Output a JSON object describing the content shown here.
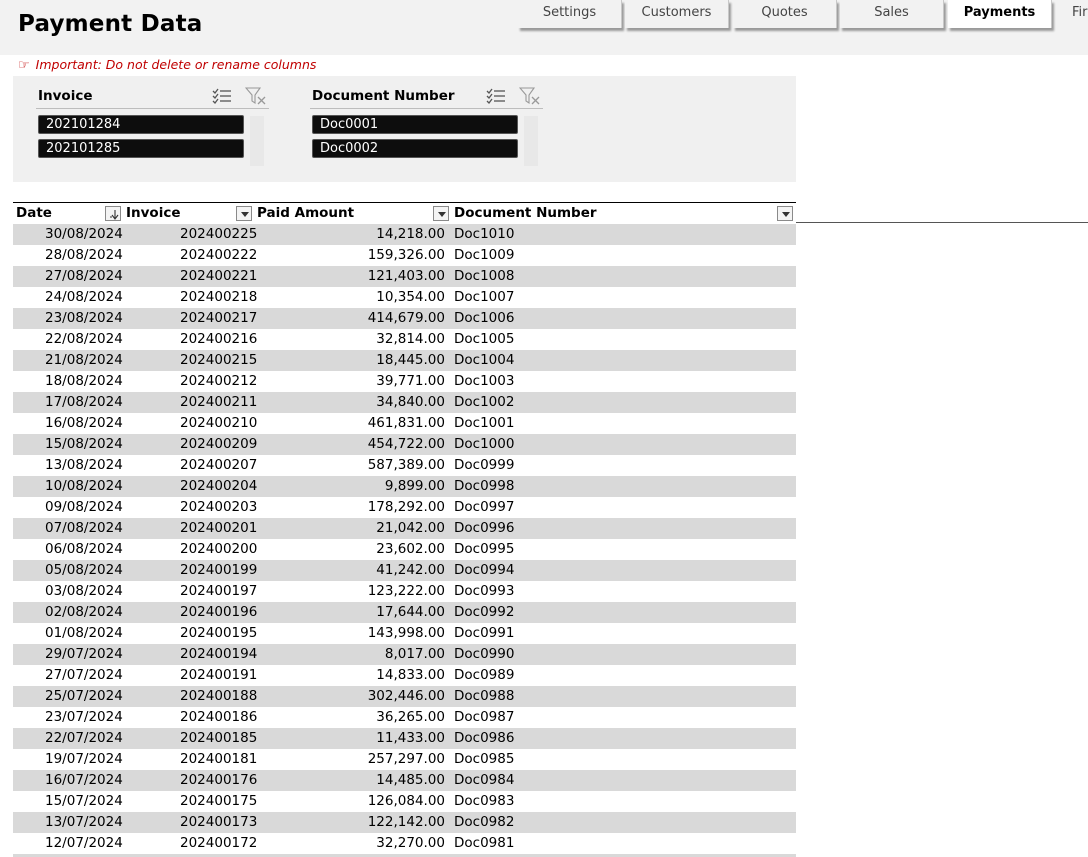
{
  "header": {
    "title": "Payment Data"
  },
  "tabs": [
    {
      "label": "Settings",
      "active": false
    },
    {
      "label": "Customers",
      "active": false
    },
    {
      "label": "Quotes",
      "active": false
    },
    {
      "label": "Sales",
      "active": false
    },
    {
      "label": "Payments",
      "active": true
    },
    {
      "label": "Fir",
      "active": false
    }
  ],
  "warning": {
    "icon": "pointing-hand-icon",
    "text": "Important: Do not delete or rename columns"
  },
  "slicers": [
    {
      "title": "Invoice",
      "items": [
        "202101284",
        "202101285"
      ]
    },
    {
      "title": "Document Number",
      "items": [
        "Doc0001",
        "Doc0002"
      ]
    }
  ],
  "table": {
    "columns": [
      "Date",
      "Invoice",
      "Paid Amount",
      "Document Number"
    ],
    "sort": {
      "column": "Date",
      "direction": "descending"
    },
    "rows": [
      [
        "30/08/2024",
        "202400225",
        "14,218.00",
        "Doc1010"
      ],
      [
        "28/08/2024",
        "202400222",
        "159,326.00",
        "Doc1009"
      ],
      [
        "27/08/2024",
        "202400221",
        "121,403.00",
        "Doc1008"
      ],
      [
        "24/08/2024",
        "202400218",
        "10,354.00",
        "Doc1007"
      ],
      [
        "23/08/2024",
        "202400217",
        "414,679.00",
        "Doc1006"
      ],
      [
        "22/08/2024",
        "202400216",
        "32,814.00",
        "Doc1005"
      ],
      [
        "21/08/2024",
        "202400215",
        "18,445.00",
        "Doc1004"
      ],
      [
        "18/08/2024",
        "202400212",
        "39,771.00",
        "Doc1003"
      ],
      [
        "17/08/2024",
        "202400211",
        "34,840.00",
        "Doc1002"
      ],
      [
        "16/08/2024",
        "202400210",
        "461,831.00",
        "Doc1001"
      ],
      [
        "15/08/2024",
        "202400209",
        "454,722.00",
        "Doc1000"
      ],
      [
        "13/08/2024",
        "202400207",
        "587,389.00",
        "Doc0999"
      ],
      [
        "10/08/2024",
        "202400204",
        "9,899.00",
        "Doc0998"
      ],
      [
        "09/08/2024",
        "202400203",
        "178,292.00",
        "Doc0997"
      ],
      [
        "07/08/2024",
        "202400201",
        "21,042.00",
        "Doc0996"
      ],
      [
        "06/08/2024",
        "202400200",
        "23,602.00",
        "Doc0995"
      ],
      [
        "05/08/2024",
        "202400199",
        "41,242.00",
        "Doc0994"
      ],
      [
        "03/08/2024",
        "202400197",
        "123,222.00",
        "Doc0993"
      ],
      [
        "02/08/2024",
        "202400196",
        "17,644.00",
        "Doc0992"
      ],
      [
        "01/08/2024",
        "202400195",
        "143,998.00",
        "Doc0991"
      ],
      [
        "29/07/2024",
        "202400194",
        "8,017.00",
        "Doc0990"
      ],
      [
        "27/07/2024",
        "202400191",
        "14,833.00",
        "Doc0989"
      ],
      [
        "25/07/2024",
        "202400188",
        "302,446.00",
        "Doc0988"
      ],
      [
        "23/07/2024",
        "202400186",
        "36,265.00",
        "Doc0987"
      ],
      [
        "22/07/2024",
        "202400185",
        "11,433.00",
        "Doc0986"
      ],
      [
        "19/07/2024",
        "202400181",
        "257,297.00",
        "Doc0985"
      ],
      [
        "16/07/2024",
        "202400176",
        "14,485.00",
        "Doc0984"
      ],
      [
        "15/07/2024",
        "202400175",
        "126,084.00",
        "Doc0983"
      ],
      [
        "13/07/2024",
        "202400173",
        "122,142.00",
        "Doc0982"
      ],
      [
        "12/07/2024",
        "202400172",
        "32,270.00",
        "Doc0981"
      ],
      [
        "",
        "",
        "",
        ""
      ]
    ]
  }
}
